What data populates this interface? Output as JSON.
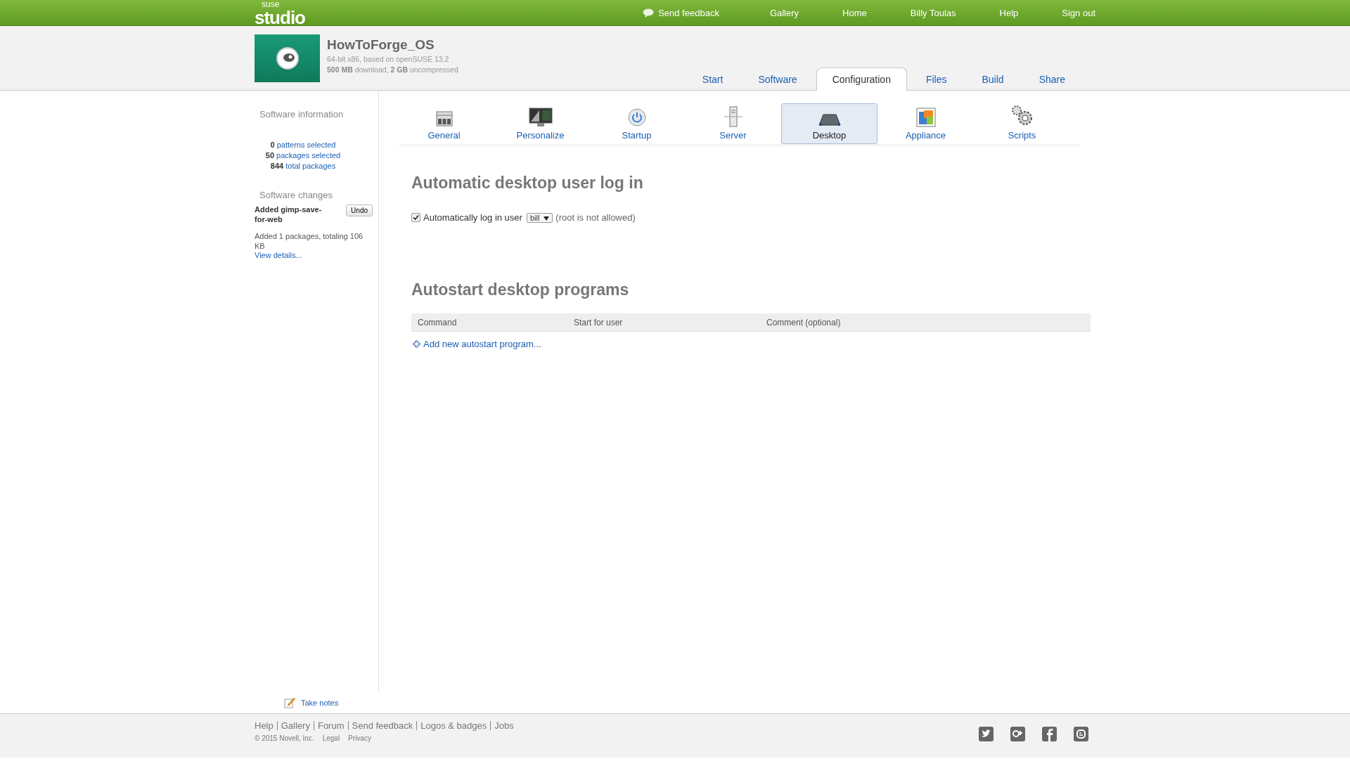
{
  "logo": {
    "top": "suse",
    "bottom": "studio"
  },
  "top_nav": {
    "feedback": "Send feedback",
    "links": [
      "Gallery",
      "Home",
      "Billy Toulas",
      "Help",
      "Sign out"
    ]
  },
  "appliance": {
    "name": "HowToForge_OS",
    "arch": "64-bit x86, based on openSUSE 13.2",
    "size": "**500 MB** download, **2 GB** uncompressed"
  },
  "tabs": [
    {
      "label": "Start",
      "selected": false
    },
    {
      "label": "Software",
      "selected": false
    },
    {
      "label": "Configuration",
      "selected": true
    },
    {
      "label": "Files",
      "selected": false
    },
    {
      "label": "Build",
      "selected": false
    },
    {
      "label": "Share",
      "selected": false
    }
  ],
  "sidebar": {
    "info_title": "Software information",
    "stats": [
      {
        "count": "0",
        "label": "patterns selected"
      },
      {
        "count": "50",
        "label": "packages selected"
      },
      {
        "count": "844",
        "label": "total packages"
      }
    ],
    "changes_title": "Software changes",
    "change": "Added gimp-save-for-web",
    "undo": "Undo",
    "summary": "Added 1 packages, totaling 106 KB",
    "details": "View details..."
  },
  "config_items": [
    {
      "kind": "general",
      "label": "General",
      "selected": false
    },
    {
      "kind": "personalize",
      "label": "Personalize",
      "selected": false
    },
    {
      "kind": "startup",
      "label": "Startup",
      "selected": false
    },
    {
      "kind": "server",
      "label": "Server",
      "selected": false
    },
    {
      "kind": "desktop",
      "label": "Desktop",
      "selected": true
    },
    {
      "kind": "appliance",
      "label": "Appliance",
      "selected": false
    },
    {
      "kind": "scripts",
      "label": "Scripts",
      "selected": false
    }
  ],
  "autologin": {
    "title": "Automatic desktop user log in",
    "checked": true,
    "label": "Automatically log in user",
    "user": "bill",
    "note": "(root is not allowed)"
  },
  "autostart": {
    "title": "Autostart desktop programs",
    "columns": [
      "Command",
      "Start for user",
      "Comment (optional)"
    ],
    "add": "Add new autostart program..."
  },
  "take_notes": "Take notes",
  "footer": {
    "links": [
      "Help",
      "Gallery",
      "Forum",
      "Send feedback",
      "Logos & badges",
      "Jobs"
    ],
    "copyright": "© 2015 Novell, Inc.",
    "legal": [
      "Legal",
      "Privacy"
    ]
  }
}
